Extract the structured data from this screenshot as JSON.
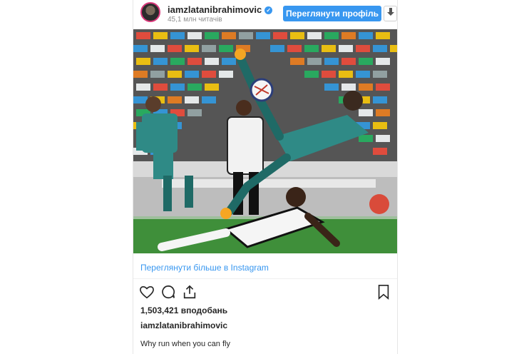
{
  "header": {
    "username": "iamzlatanibrahimovic",
    "verified_icon": "verified-badge-icon",
    "followers": "45,1 млн читачів",
    "view_profile_label": "Переглянути профіль",
    "download_icon": "download-icon"
  },
  "post": {
    "image_description_icon": "post-photo",
    "see_more_label": "Переглянути більше в Instagram",
    "likes": "1,503,421 вподобань",
    "caption_username": "iamzlatanibrahimovic",
    "caption_text": "Why run when you can fly",
    "actions": [
      "heart-icon",
      "comment-icon",
      "share-icon",
      "bookmark-icon"
    ]
  },
  "colors": {
    "accent": "#3897f0",
    "text": "#262626",
    "muted": "#8e8e8e"
  }
}
